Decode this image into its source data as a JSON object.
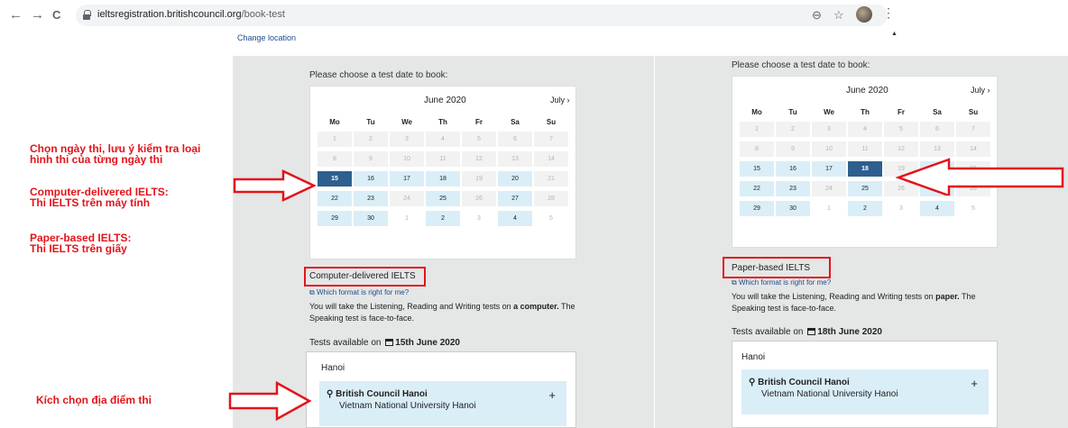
{
  "browser": {
    "url_domain": "ieltsregistration.britishcouncil.org",
    "url_path": "/book-test",
    "back_icon": "←",
    "forward_icon": "→",
    "reload_icon": "C",
    "zoom_icon": "⊖",
    "star_icon": "☆",
    "menu_icon": "⋮"
  },
  "page": {
    "change_location": "Change location",
    "scroll_up": "▲"
  },
  "left_panel": {
    "choose_text": "Please choose a test date to book:",
    "calendar": {
      "month": "June 2020",
      "next": "July ›",
      "day_headers": [
        "Mo",
        "Tu",
        "We",
        "Th",
        "Fr",
        "Sa",
        "Su"
      ]
    },
    "format_title": "Computer-delivered IELTS",
    "format_link": "Which format is right for me?",
    "format_desc_1": "You will take the Listening, Reading and Writing tests on",
    "format_desc_bold": "a computer.",
    "format_desc_2": "The Speaking test is face-to-face.",
    "tests_prefix": "Tests available on",
    "tests_date": "15th June 2020",
    "city": "Hanoi",
    "venue_name": "British Council Hanoi",
    "venue_sub": "Vietnam National University Hanoi",
    "venue_plus": "+"
  },
  "right_panel": {
    "choose_text": "Please choose a test date to book:",
    "calendar": {
      "month": "June 2020",
      "next": "July ›",
      "day_headers": [
        "Mo",
        "Tu",
        "We",
        "Th",
        "Fr",
        "Sa",
        "Su"
      ]
    },
    "format_title": "Paper-based IELTS",
    "format_link": "Which format is right for me?",
    "format_desc_1": "You will take the Listening, Reading and Writing tests on",
    "format_desc_bold": "paper.",
    "format_desc_2": "The Speaking test is face-to-face.",
    "tests_prefix": "Tests available on",
    "tests_date": "18th June 2020",
    "city": "Hanoi",
    "venue_name": "British Council Hanoi",
    "venue_sub": "Vietnam National University Hanoi",
    "venue_plus": "+"
  },
  "annotations": {
    "note1_line1": "Chọn ngày thi, lưu ý kiểm tra loại",
    "note1_line2": "hình thi của từng ngày thi",
    "note2_line1": "Computer-delivered IELTS:",
    "note2_line2": "Thi IELTS trên máy tính",
    "note3_line1": "Paper-based IELTS:",
    "note3_line2": "Thi IELTS trên giấy",
    "note4": "Kích chọn địa điểm thi"
  },
  "colors": {
    "selected": "#2d5f8f",
    "available": "#daeef7",
    "annotation_red": "#e3141b"
  }
}
